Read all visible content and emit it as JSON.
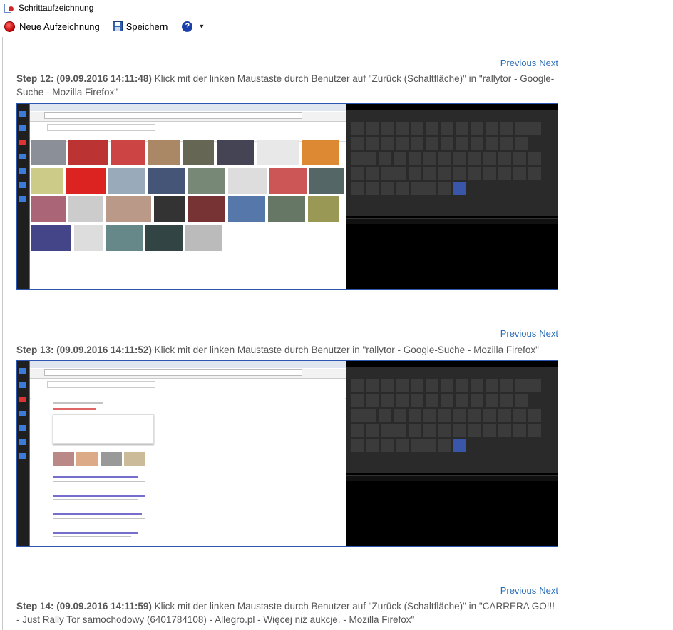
{
  "window": {
    "title": "Schrittaufzeichnung"
  },
  "toolbar": {
    "new_recording": "Neue Aufzeichnung",
    "save": "Speichern",
    "help_icon": "help-icon",
    "dropdown_icon": "chevron-down-icon"
  },
  "nav": {
    "previous": "Previous",
    "next": "Next"
  },
  "steps": [
    {
      "header": "Step 12: (09.09.2016 14:11:48)",
      "text": " Klick mit der linken Maustaste durch Benutzer auf \"Zurück (Schaltfläche)\" in \"rallytor - Google-Suche - Mozilla Firefox\""
    },
    {
      "header": "Step 13: (09.09.2016 14:11:52)",
      "text": " Klick mit der linken Maustaste durch Benutzer in \"rallytor - Google-Suche - Mozilla Firefox\""
    },
    {
      "header": "Step 14: (09.09.2016 14:11:59)",
      "text": " Klick mit der linken Maustaste durch Benutzer auf \"Zurück (Schaltfläche)\" in \"CARRERA GO!!! - Just Rally Tor samochodowy (6401784108) - Allegro.pl - Więcej niż aukcje. - Mozilla Firefox\""
    }
  ],
  "colors": {
    "link": "#2a6db7",
    "screenshot_border": "#2c56b0",
    "record": "#c40000"
  }
}
